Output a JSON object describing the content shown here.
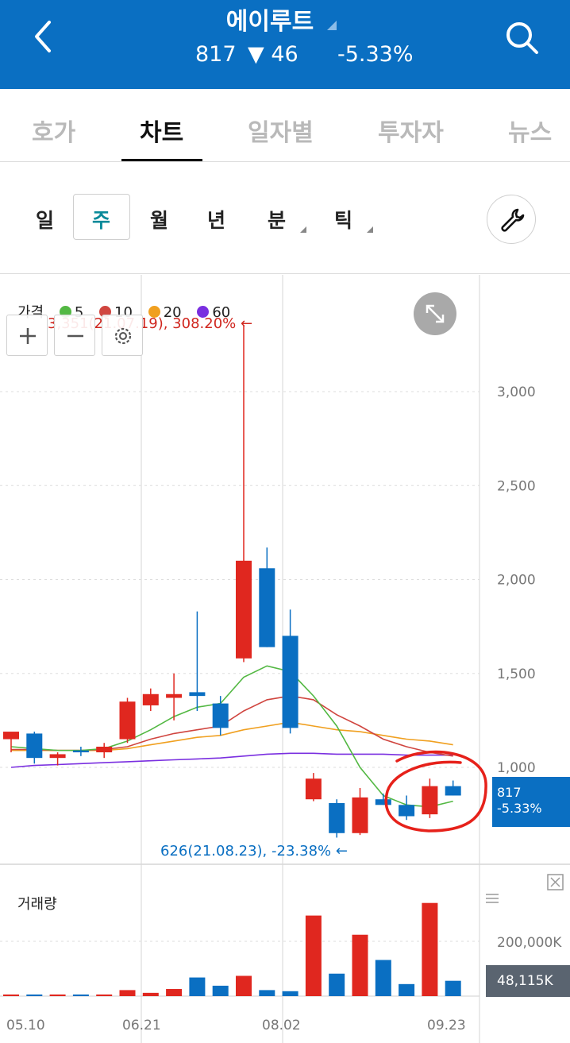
{
  "header": {
    "title": "에이루트",
    "price": "817",
    "change": "▼ 46",
    "rate": "-5.33%"
  },
  "tabs": [
    "호가",
    "차트",
    "일자별",
    "투자자",
    "뉴스"
  ],
  "active_tab": "차트",
  "periods": [
    "일",
    "주",
    "월",
    "년",
    "분",
    "틱"
  ],
  "active_period": "주",
  "legend": {
    "label": "가격",
    "items": [
      {
        "label": "5",
        "color": "#53b843"
      },
      {
        "label": "10",
        "color": "#d0453f"
      },
      {
        "label": "20",
        "color": "#f0a020"
      },
      {
        "label": "60",
        "color": "#7a2fe0"
      }
    ]
  },
  "annotations": {
    "high": "3,351(21.07.19), 308.20% ←",
    "low": "626(21.08.23), -23.38% ←"
  },
  "current_tag": {
    "price": "817",
    "rate": "-5.33%"
  },
  "volume": {
    "title": "거래량",
    "tag": "48,115K",
    "axis_label": "200,000K"
  },
  "colors": {
    "up": "#e0271f",
    "down": "#0a6fc2",
    "accent": "#0a6fc2"
  },
  "chart_data": {
    "type": "candlestick",
    "x_labels": [
      "05.10",
      "06.21",
      "08.02",
      "09.23"
    ],
    "y_ticks": [
      "3,000",
      "2,500",
      "2,000",
      "1,500",
      "1,000"
    ],
    "ylim": [
      700,
      3400
    ],
    "candles": [
      {
        "o": 1150,
        "h": 1180,
        "l": 1080,
        "c": 1190
      },
      {
        "o": 1180,
        "h": 1190,
        "l": 1020,
        "c": 1050
      },
      {
        "o": 1050,
        "h": 1080,
        "l": 1010,
        "c": 1070
      },
      {
        "o": 1090,
        "h": 1110,
        "l": 1060,
        "c": 1080
      },
      {
        "o": 1080,
        "h": 1130,
        "l": 1050,
        "c": 1110
      },
      {
        "o": 1150,
        "h": 1370,
        "l": 1130,
        "c": 1350
      },
      {
        "o": 1330,
        "h": 1420,
        "l": 1300,
        "c": 1390
      },
      {
        "o": 1370,
        "h": 1500,
        "l": 1250,
        "c": 1390
      },
      {
        "o": 1400,
        "h": 1830,
        "l": 1300,
        "c": 1380
      },
      {
        "o": 1340,
        "h": 1380,
        "l": 1170,
        "c": 1210
      },
      {
        "o": 1580,
        "h": 3351,
        "l": 1560,
        "c": 2100
      },
      {
        "o": 2060,
        "h": 2170,
        "l": 1640,
        "c": 1640
      },
      {
        "o": 1700,
        "h": 1840,
        "l": 1180,
        "c": 1210
      },
      {
        "o": 830,
        "h": 970,
        "l": 820,
        "c": 940
      },
      {
        "o": 810,
        "h": 830,
        "l": 626,
        "c": 650
      },
      {
        "o": 650,
        "h": 890,
        "l": 640,
        "c": 840
      },
      {
        "o": 830,
        "h": 860,
        "l": 800,
        "c": 800
      },
      {
        "o": 800,
        "h": 850,
        "l": 720,
        "c": 740
      },
      {
        "o": 750,
        "h": 940,
        "l": 730,
        "c": 900
      },
      {
        "o": 900,
        "h": 930,
        "l": 850,
        "c": 850
      }
    ],
    "ma5": [
      1110,
      1100,
      1090,
      1090,
      1100,
      1140,
      1200,
      1270,
      1320,
      1340,
      1480,
      1540,
      1510,
      1380,
      1220,
      1000,
      850,
      800,
      790,
      820
    ],
    "ma10": [
      1095,
      1095,
      1090,
      1090,
      1095,
      1110,
      1150,
      1180,
      1200,
      1220,
      1300,
      1360,
      1380,
      1360,
      1280,
      1220,
      1150,
      1110,
      1080,
      1060
    ],
    "ma20": [
      1090,
      1090,
      1090,
      1090,
      1090,
      1100,
      1120,
      1140,
      1160,
      1170,
      1200,
      1220,
      1240,
      1220,
      1200,
      1190,
      1170,
      1150,
      1140,
      1120
    ],
    "ma60": [
      1000,
      1010,
      1015,
      1020,
      1025,
      1030,
      1035,
      1040,
      1045,
      1050,
      1060,
      1070,
      1075,
      1075,
      1070,
      1070,
      1070,
      1065,
      1065,
      1065
    ],
    "volumes": [
      3000,
      3000,
      3000,
      3000,
      3000,
      11000,
      6000,
      13000,
      34000,
      19000,
      37000,
      11000,
      9000,
      147000,
      41000,
      112000,
      66000,
      22000,
      170000,
      28000
    ]
  }
}
